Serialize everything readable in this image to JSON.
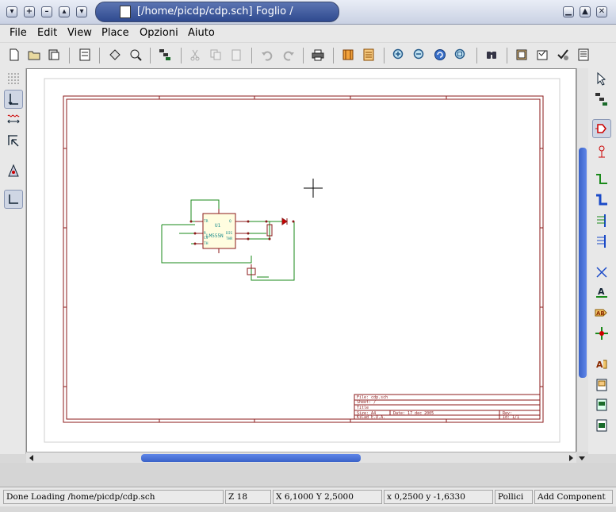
{
  "window": {
    "title": "[/home/picdp/cdp.sch]  Foglio /",
    "title_buttons": [
      "▾",
      "+",
      "–",
      "▴",
      "▾"
    ],
    "control_buttons": [
      "▁",
      "▲",
      "✕"
    ]
  },
  "menu": [
    "File",
    "Edit",
    "View",
    "Place",
    "Opzioni",
    "Aiuto"
  ],
  "toolbar": {
    "icons": [
      "new-document-icon",
      "open-folder-icon",
      "save-icon",
      "sheet-icon",
      "load-icon",
      "zoom-rotate-icon",
      "hierarchy-icon",
      "cut-icon",
      "copy-icon",
      "paste-icon",
      "undo-icon",
      "redo-icon",
      "print-icon",
      "library-icon",
      "edit-library-icon",
      "zoom-in-icon",
      "zoom-out-icon",
      "redraw-icon",
      "zoom-fit-icon",
      "find-icon",
      "netlist-icon",
      "annotate-icon",
      "erc-icon",
      "bom-icon"
    ]
  },
  "left_toolbar": {
    "icons": [
      "grid-icon",
      "units-icon",
      "inch-mm-icon",
      "cursor-icon",
      "hidden-pins-icon",
      "bus-wire-icon"
    ]
  },
  "right_toolbar": {
    "icons": [
      "select-arrow-icon",
      "hierarchy-nav-icon",
      "place-component-icon",
      "place-power-icon",
      "place-wire-icon",
      "place-bus-icon",
      "wire-bus-entry-icon",
      "bus-bus-entry-icon",
      "no-connect-icon",
      "place-label-icon",
      "global-label-icon",
      "junction-icon",
      "hierarchical-label-icon",
      "hierarchical-sheet-icon",
      "import-pin-icon",
      "sheet-pin-icon"
    ]
  },
  "schematic": {
    "component_ref": "U1",
    "component_value": "LM555N",
    "pins_left": [
      "TR",
      "R",
      "CV",
      "TH"
    ],
    "pins_right": [
      "Q",
      "DIS",
      "THR"
    ],
    "title_block": {
      "file": "File: cdp.sch",
      "sheet": "Sheet: /",
      "title": "Title",
      "size": "Size: A4",
      "date": "Date: 17 dec 2005",
      "rev": "Rev:",
      "kicad": "KiCad E.D.A.",
      "id": "Id: 1/1"
    }
  },
  "status": {
    "message": "Done Loading /home/picdp/cdp.sch",
    "zoom": "Z 18",
    "abs_coords": "X 6,1000  Y 2,5000",
    "rel_coords": "x 0,2500  y -1,6330",
    "units": "Pollici",
    "mode": "Add Component"
  }
}
